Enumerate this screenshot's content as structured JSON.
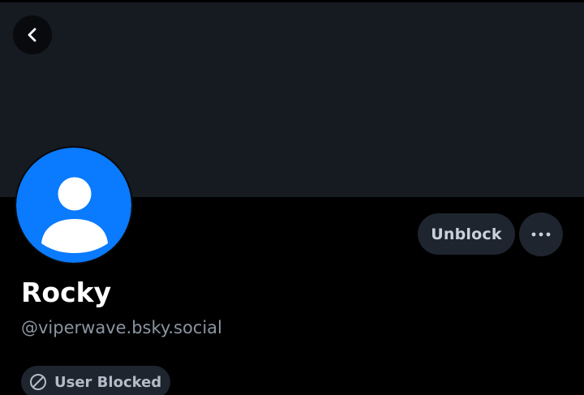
{
  "header": {
    "back_icon": "chevron-left-icon"
  },
  "profile": {
    "display_name": "Rocky",
    "handle": "@viperwave.bsky.social",
    "avatar_icon": "default-user-avatar-icon",
    "avatar_color": "#0a7aff"
  },
  "actions": {
    "unblock_label": "Unblock",
    "more_icon": "ellipsis-icon"
  },
  "status": {
    "blocked_label": "User Blocked",
    "blocked_icon": "ban-icon"
  },
  "colors": {
    "banner": "#161b22",
    "background": "#000000",
    "pill": "#1e252e"
  }
}
